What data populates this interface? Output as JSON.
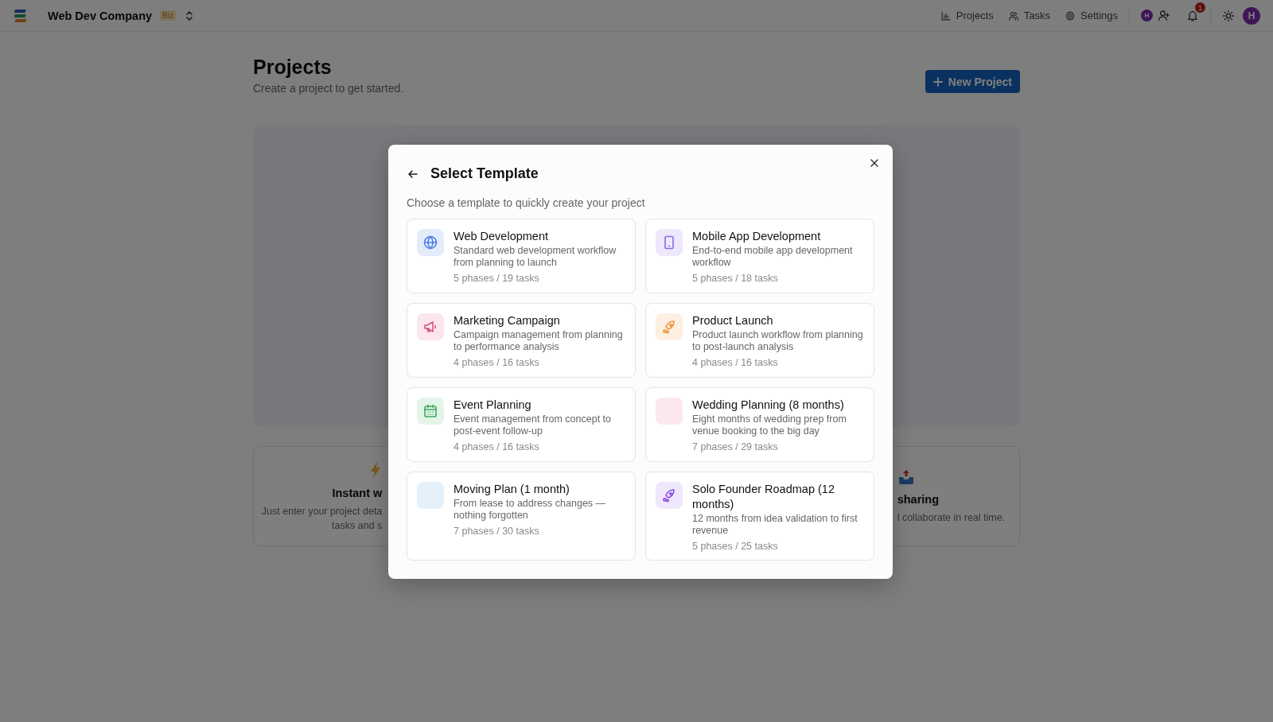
{
  "header": {
    "workspace": "Web Dev Company",
    "plan_badge": "Biz",
    "nav": [
      {
        "label": "Projects",
        "selected": false
      },
      {
        "label": "Tasks",
        "selected": false
      },
      {
        "label": "Settings",
        "selected": false
      }
    ],
    "member_avatar": "H",
    "notification_count": "1",
    "user_avatar": "H"
  },
  "page": {
    "title": "Projects",
    "subtitle": "Create a project to get started.",
    "new_button": "New Project",
    "features": [
      {
        "title": "Instant w",
        "text_lines": [
          "Just enter your project deta",
          "tasks and s"
        ]
      },
      {
        "title": "sharing",
        "text_lines": [
          "l collaborate in real time."
        ]
      }
    ]
  },
  "modal": {
    "title": "Select Template",
    "subtitle": "Choose a template to quickly create your project",
    "templates": [
      {
        "name": "Web Development",
        "description": "Standard web development workflow from planning to launch",
        "meta": "5 phases / 19 tasks",
        "color": "#e4ecfc"
      },
      {
        "name": "Mobile App Development",
        "description": "End-to-end mobile app development workflow",
        "meta": "5 phases / 18 tasks",
        "color": "#ede8fc"
      },
      {
        "name": "Marketing Campaign",
        "description": "Campaign management from planning to performance analysis",
        "meta": "4 phases / 16 tasks",
        "color": "#fbe6ee"
      },
      {
        "name": "Product Launch",
        "description": "Product launch workflow from planning to post-launch analysis",
        "meta": "4 phases / 16 tasks",
        "color": "#fdefe2"
      },
      {
        "name": "Event Planning",
        "description": "Event management from concept to post-event follow-up",
        "meta": "4 phases / 16 tasks",
        "color": "#e4f4e8"
      },
      {
        "name": "Wedding Planning (8 months)",
        "description": "Eight months of wedding prep from venue booking to the big day",
        "meta": "7 phases / 29 tasks",
        "color": "#fbe8ef"
      },
      {
        "name": "Moving Plan (1 month)",
        "description": "From lease to address changes — nothing forgotten",
        "meta": "7 phases / 30 tasks",
        "color": "#e4f0fa"
      },
      {
        "name": "Solo Founder Roadmap (12 months)",
        "description": "12 months from idea validation to first revenue",
        "meta": "5 phases / 25 tasks",
        "color": "#efe7fc"
      }
    ]
  }
}
